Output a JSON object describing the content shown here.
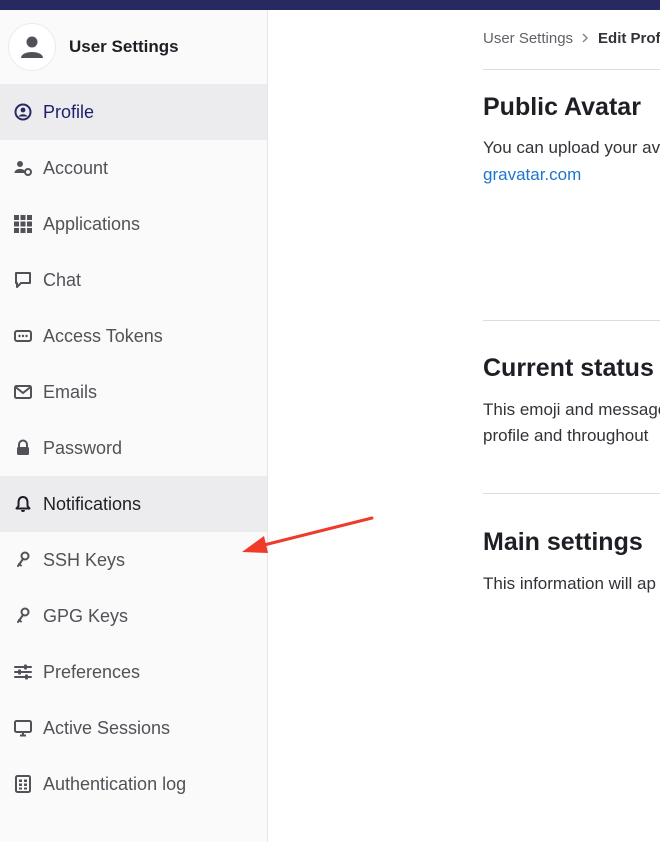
{
  "sidebar": {
    "title": "User Settings",
    "items": [
      {
        "label": "Profile",
        "icon": "profile-icon",
        "state": "active"
      },
      {
        "label": "Account",
        "icon": "account-icon"
      },
      {
        "label": "Applications",
        "icon": "applications-icon"
      },
      {
        "label": "Chat",
        "icon": "chat-icon"
      },
      {
        "label": "Access Tokens",
        "icon": "token-icon"
      },
      {
        "label": "Emails",
        "icon": "mail-icon"
      },
      {
        "label": "Password",
        "icon": "lock-icon"
      },
      {
        "label": "Notifications",
        "icon": "bell-icon",
        "state": "hover"
      },
      {
        "label": "SSH Keys",
        "icon": "key-icon"
      },
      {
        "label": "GPG Keys",
        "icon": "key-icon"
      },
      {
        "label": "Preferences",
        "icon": "preferences-icon"
      },
      {
        "label": "Active Sessions",
        "icon": "monitor-icon"
      },
      {
        "label": "Authentication log",
        "icon": "log-icon"
      }
    ]
  },
  "breadcrumb": {
    "parent": "User Settings",
    "current": "Edit Profil"
  },
  "sections": {
    "avatar": {
      "title": "Public Avatar",
      "text": "You can upload your av",
      "link": "gravatar.com"
    },
    "status": {
      "title": "Current status",
      "text_line1": "This emoji and message",
      "text_line2": "profile and throughout"
    },
    "main": {
      "title": "Main settings",
      "text": "This information will ap"
    }
  },
  "colors": {
    "topbar": "#292961",
    "active_text": "#1f1e6b",
    "link": "#1f75cb",
    "annotation_arrow": "#f03a2c"
  }
}
